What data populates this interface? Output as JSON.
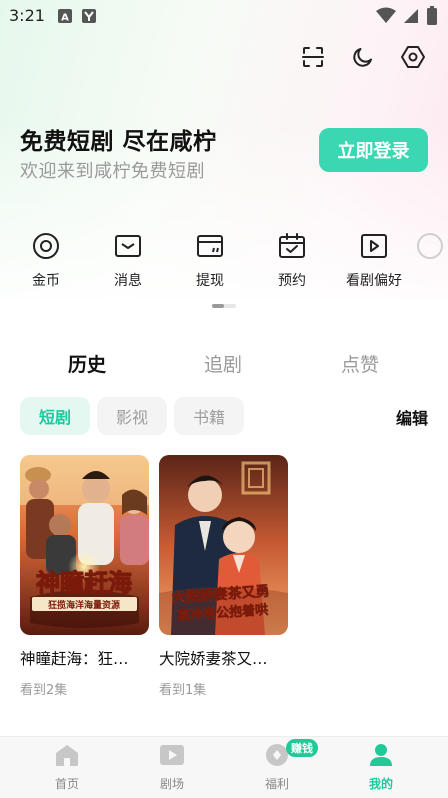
{
  "status_bar": {
    "time": "3:21",
    "left_icons": [
      "a-box-icon",
      "y-box-icon"
    ],
    "right_icons": [
      "wifi-icon",
      "signal-icon",
      "battery-icon"
    ]
  },
  "header": {
    "icons": [
      "scan-icon",
      "moon-icon",
      "settings-icon"
    ]
  },
  "welcome": {
    "title": "免费短剧 尽在咸柠",
    "subtitle": "欢迎来到咸柠免费短剧",
    "login_label": "立即登录"
  },
  "quick_menu": {
    "items": [
      {
        "label": "金币",
        "icon": "coin-icon"
      },
      {
        "label": "消息",
        "icon": "mail-icon"
      },
      {
        "label": "提现",
        "icon": "wallet-icon"
      },
      {
        "label": "预约",
        "icon": "calendar-icon"
      },
      {
        "label": "看剧偏好",
        "icon": "play-icon"
      }
    ]
  },
  "tabs": [
    {
      "label": "历史",
      "active": true
    },
    {
      "label": "追剧",
      "active": false
    },
    {
      "label": "点赞",
      "active": false
    }
  ],
  "chips": [
    {
      "label": "短剧",
      "active": true
    },
    {
      "label": "影视",
      "active": false
    },
    {
      "label": "书籍",
      "active": false
    }
  ],
  "edit_label": "编辑",
  "history": [
    {
      "title": "神瞳赶海：狂…",
      "progress": "看到2集",
      "poster_text": "神瞳赶海",
      "poster_subtext": "狂揽海洋海量资源"
    },
    {
      "title": "大院娇妻茶又…",
      "progress": "看到1集",
      "poster_text": "大院娇妻茶又勇",
      "poster_subtext": "高冷老公抱着哄"
    }
  ],
  "bottom_nav": {
    "items": [
      {
        "label": "首页",
        "icon": "home-icon",
        "active": false
      },
      {
        "label": "剧场",
        "icon": "theater-icon",
        "active": false
      },
      {
        "label": "福利",
        "icon": "gift-icon",
        "active": false
      },
      {
        "label": "我的",
        "icon": "user-icon",
        "active": true
      }
    ],
    "badge": "赚钱"
  },
  "colors": {
    "accent": "#3ad7b2",
    "accent_text": "#1fc89e"
  }
}
